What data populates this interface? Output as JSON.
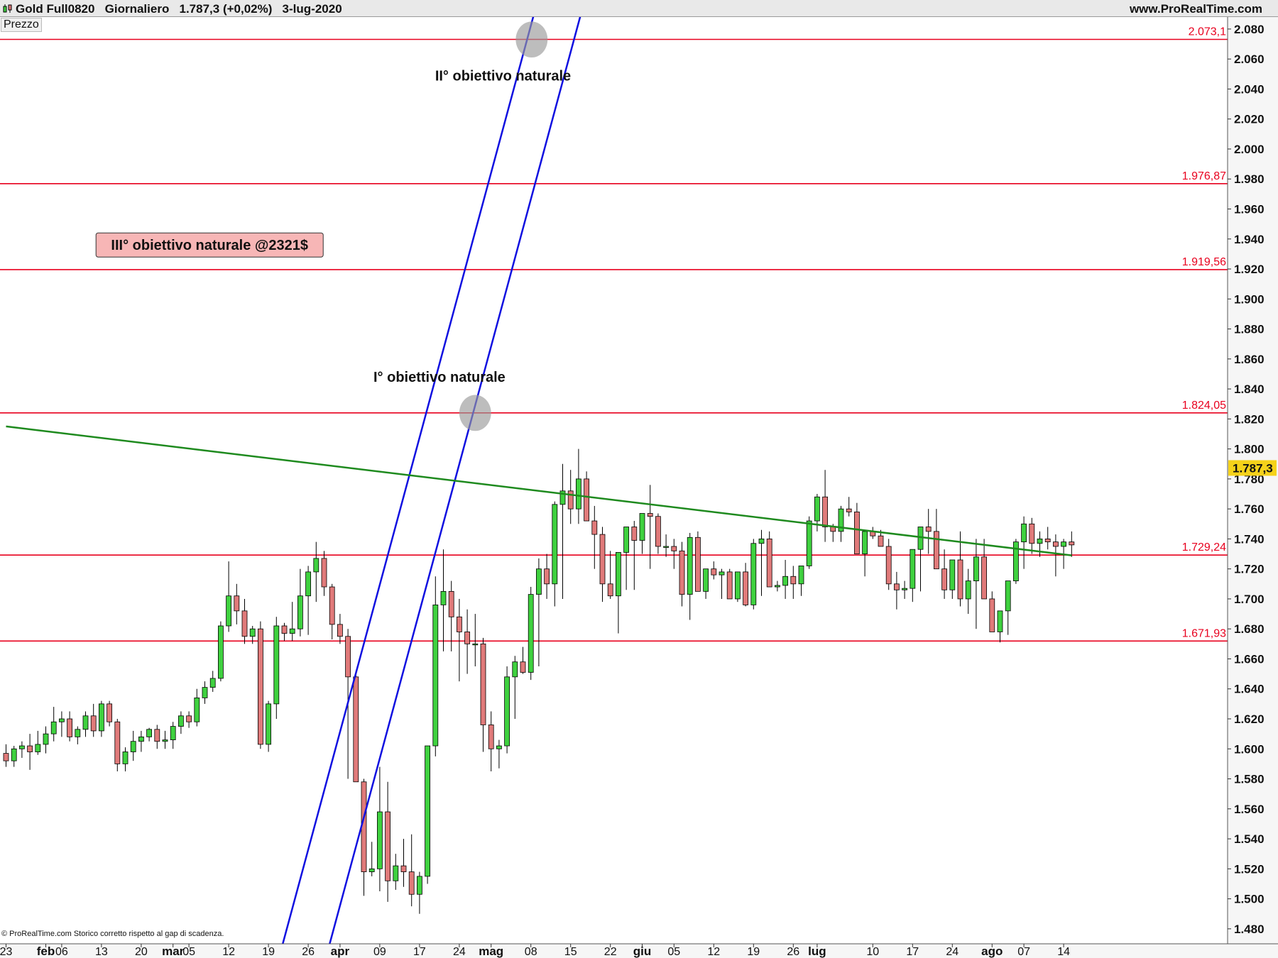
{
  "header": {
    "title": "Gold Full0820   Giornaliero   1.787,3 (+0,02%)   3-lug-2020",
    "website": "www.ProRealTime.com"
  },
  "panel_label": "Prezzo",
  "footer": {
    "copyright": "© ProRealTime.com  Storico corretto rispetto al gap di scadenza."
  },
  "colors": {
    "up": "#3fd13f",
    "down": "#e07a7a",
    "level": "#e8001e",
    "channel": "#1010e0",
    "trend": "#1e8a1e",
    "last_price_bg": "#f5d21a"
  },
  "chart_data": {
    "type": "candlestick",
    "ylim": [
      1470,
      2088
    ],
    "y_ticks": [
      "2.080",
      "2.060",
      "2.040",
      "2.020",
      "2.000",
      "1.980",
      "1.960",
      "1.940",
      "1.920",
      "1.900",
      "1.880",
      "1.860",
      "1.840",
      "1.820",
      "1.800",
      "1.780",
      "1.760",
      "1.740",
      "1.720",
      "1.700",
      "1.680",
      "1.660",
      "1.640",
      "1.620",
      "1.600",
      "1.580",
      "1.560",
      "1.540",
      "1.520",
      "1.500",
      "1.480"
    ],
    "x_ticks": [
      {
        "i": 0,
        "label": "23"
      },
      {
        "i": 5,
        "label": "feb"
      },
      {
        "i": 7,
        "label": "06"
      },
      {
        "i": 12,
        "label": "13"
      },
      {
        "i": 17,
        "label": "20"
      },
      {
        "i": 21,
        "label": "mar"
      },
      {
        "i": 23,
        "label": "05"
      },
      {
        "i": 28,
        "label": "12"
      },
      {
        "i": 33,
        "label": "19"
      },
      {
        "i": 38,
        "label": "26"
      },
      {
        "i": 42,
        "label": "apr"
      },
      {
        "i": 47,
        "label": "09"
      },
      {
        "i": 52,
        "label": "17"
      },
      {
        "i": 57,
        "label": "24"
      },
      {
        "i": 61,
        "label": "mag"
      },
      {
        "i": 66,
        "label": "08"
      },
      {
        "i": 71,
        "label": "15"
      },
      {
        "i": 76,
        "label": "22"
      },
      {
        "i": 80,
        "label": "giu"
      },
      {
        "i": 84,
        "label": "05"
      },
      {
        "i": 89,
        "label": "12"
      },
      {
        "i": 94,
        "label": "19"
      },
      {
        "i": 99,
        "label": "26"
      },
      {
        "i": 102,
        "label": "lug"
      },
      {
        "i": 109,
        "label": "10"
      },
      {
        "i": 114,
        "label": "17"
      },
      {
        "i": 119,
        "label": "24"
      },
      {
        "i": 124,
        "label": "ago"
      },
      {
        "i": 128,
        "label": "07"
      },
      {
        "i": 133,
        "label": "14"
      }
    ],
    "last_price": {
      "value": 1787.3,
      "label": "1.787,3"
    },
    "levels": [
      {
        "value": 2073.1,
        "label": "2.073,1"
      },
      {
        "value": 1976.87,
        "label": "1.976,87"
      },
      {
        "value": 1919.56,
        "label": "1.919,56"
      },
      {
        "value": 1824.05,
        "label": "1.824,05"
      },
      {
        "value": 1729.24,
        "label": "1.729,24"
      },
      {
        "value": 1671.93,
        "label": "1.671,93"
      }
    ],
    "channel_lines": [
      {
        "from": {
          "i": 34.8,
          "price": 1470
        },
        "to": {
          "i": 66.8,
          "price": 2098
        }
      },
      {
        "from": {
          "i": 40.7,
          "price": 1470
        },
        "to": {
          "i": 72.7,
          "price": 2098
        }
      }
    ],
    "trendline": {
      "from": {
        "i": 0,
        "price": 1815
      },
      "to": {
        "i": 134,
        "price": 1729
      }
    },
    "markers": [
      {
        "i": 66.1,
        "price": 2073,
        "rx": 2.0,
        "ry": 12
      },
      {
        "i": 59.0,
        "price": 1824,
        "rx": 2.0,
        "ry": 12
      }
    ],
    "annotations": [
      {
        "id": "ii",
        "text": "II° obiettivo naturale",
        "i": 62.5,
        "price": 2049,
        "boxed": false
      },
      {
        "id": "i",
        "text": "I° obiettivo naturale",
        "i": 54.5,
        "price": 1848,
        "boxed": false
      },
      {
        "id": "iii",
        "text": "III° obiettivo naturale @2321$",
        "i": 25.6,
        "price": 1936,
        "boxed": true
      }
    ],
    "candles": [
      [
        1597,
        1603,
        1588,
        1592
      ],
      [
        1592,
        1602,
        1588,
        1600
      ],
      [
        1600,
        1605,
        1594,
        1602
      ],
      [
        1602,
        1610,
        1586,
        1598
      ],
      [
        1598,
        1612,
        1596,
        1603
      ],
      [
        1603,
        1615,
        1597,
        1610
      ],
      [
        1610,
        1628,
        1605,
        1618
      ],
      [
        1618,
        1625,
        1608,
        1620
      ],
      [
        1620,
        1625,
        1605,
        1608
      ],
      [
        1608,
        1615,
        1603,
        1613
      ],
      [
        1613,
        1625,
        1608,
        1622
      ],
      [
        1622,
        1630,
        1608,
        1612
      ],
      [
        1612,
        1632,
        1608,
        1630
      ],
      [
        1630,
        1632,
        1615,
        1618
      ],
      [
        1618,
        1620,
        1585,
        1590
      ],
      [
        1590,
        1601,
        1585,
        1598
      ],
      [
        1598,
        1612,
        1592,
        1605
      ],
      [
        1605,
        1612,
        1598,
        1608
      ],
      [
        1608,
        1614,
        1605,
        1613
      ],
      [
        1613,
        1616,
        1600,
        1605
      ],
      [
        1605,
        1612,
        1600,
        1606
      ],
      [
        1606,
        1618,
        1600,
        1615
      ],
      [
        1615,
        1625,
        1610,
        1622
      ],
      [
        1622,
        1625,
        1614,
        1618
      ],
      [
        1618,
        1640,
        1615,
        1634
      ],
      [
        1634,
        1645,
        1630,
        1641
      ],
      [
        1641,
        1652,
        1638,
        1647
      ],
      [
        1647,
        1685,
        1645,
        1682
      ],
      [
        1682,
        1725,
        1678,
        1702
      ],
      [
        1702,
        1710,
        1683,
        1692
      ],
      [
        1692,
        1700,
        1670,
        1675
      ],
      [
        1675,
        1682,
        1670,
        1680
      ],
      [
        1680,
        1685,
        1600,
        1603
      ],
      [
        1603,
        1632,
        1598,
        1630
      ],
      [
        1630,
        1688,
        1620,
        1682
      ],
      [
        1682,
        1684,
        1672,
        1677
      ],
      [
        1677,
        1698,
        1672,
        1680
      ],
      [
        1680,
        1720,
        1675,
        1702
      ],
      [
        1702,
        1722,
        1676,
        1718
      ],
      [
        1718,
        1738,
        1698,
        1727
      ],
      [
        1727,
        1732,
        1702,
        1708
      ],
      [
        1708,
        1710,
        1673,
        1683
      ],
      [
        1683,
        1690,
        1670,
        1675
      ],
      [
        1675,
        1680,
        1580,
        1648
      ],
      [
        1648,
        1652,
        1595,
        1578
      ],
      [
        1578,
        1580,
        1502,
        1518
      ],
      [
        1518,
        1538,
        1515,
        1520
      ],
      [
        1520,
        1588,
        1505,
        1558
      ],
      [
        1558,
        1578,
        1498,
        1512
      ],
      [
        1512,
        1530,
        1506,
        1522
      ],
      [
        1522,
        1540,
        1508,
        1518
      ],
      [
        1518,
        1543,
        1495,
        1503
      ],
      [
        1503,
        1518,
        1490,
        1515
      ],
      [
        1515,
        1602,
        1510,
        1602
      ],
      [
        1602,
        1715,
        1595,
        1696
      ],
      [
        1696,
        1733,
        1665,
        1705
      ],
      [
        1705,
        1712,
        1665,
        1688
      ],
      [
        1688,
        1700,
        1645,
        1678
      ],
      [
        1678,
        1693,
        1650,
        1670
      ],
      [
        1670,
        1690,
        1655,
        1670
      ],
      [
        1670,
        1674,
        1598,
        1616
      ],
      [
        1616,
        1625,
        1585,
        1600
      ],
      [
        1600,
        1606,
        1587,
        1602
      ],
      [
        1602,
        1655,
        1597,
        1648
      ],
      [
        1648,
        1662,
        1620,
        1658
      ],
      [
        1658,
        1668,
        1650,
        1651
      ],
      [
        1651,
        1708,
        1646,
        1703
      ],
      [
        1703,
        1727,
        1655,
        1720
      ],
      [
        1720,
        1730,
        1700,
        1710
      ],
      [
        1710,
        1765,
        1695,
        1763
      ],
      [
        1763,
        1790,
        1700,
        1772
      ],
      [
        1772,
        1786,
        1750,
        1760
      ],
      [
        1760,
        1800,
        1750,
        1780
      ],
      [
        1780,
        1785,
        1760,
        1752
      ],
      [
        1752,
        1762,
        1720,
        1743
      ],
      [
        1743,
        1748,
        1698,
        1710
      ],
      [
        1710,
        1732,
        1700,
        1702
      ],
      [
        1702,
        1728,
        1677,
        1731
      ],
      [
        1731,
        1740,
        1706,
        1748
      ],
      [
        1748,
        1752,
        1706,
        1739
      ],
      [
        1739,
        1755,
        1730,
        1757
      ],
      [
        1757,
        1776,
        1720,
        1755
      ],
      [
        1755,
        1757,
        1730,
        1735
      ],
      [
        1735,
        1743,
        1728,
        1735
      ],
      [
        1735,
        1740,
        1720,
        1732
      ],
      [
        1732,
        1738,
        1695,
        1703
      ],
      [
        1703,
        1744,
        1686,
        1741
      ],
      [
        1741,
        1745,
        1705,
        1705
      ],
      [
        1705,
        1715,
        1700,
        1720
      ],
      [
        1720,
        1725,
        1713,
        1716
      ],
      [
        1716,
        1720,
        1700,
        1718
      ],
      [
        1718,
        1720,
        1705,
        1700
      ],
      [
        1700,
        1712,
        1698,
        1718
      ],
      [
        1718,
        1724,
        1695,
        1696
      ],
      [
        1696,
        1740,
        1693,
        1737
      ],
      [
        1737,
        1746,
        1702,
        1740
      ],
      [
        1740,
        1745,
        1733,
        1708
      ],
      [
        1708,
        1712,
        1705,
        1709
      ],
      [
        1709,
        1726,
        1700,
        1715
      ],
      [
        1715,
        1722,
        1700,
        1710
      ],
      [
        1710,
        1720,
        1702,
        1722
      ],
      [
        1722,
        1755,
        1720,
        1752
      ],
      [
        1752,
        1770,
        1745,
        1768
      ],
      [
        1768,
        1786,
        1738,
        1748
      ],
      [
        1748,
        1750,
        1738,
        1745
      ],
      [
        1745,
        1762,
        1738,
        1760
      ],
      [
        1760,
        1768,
        1755,
        1758
      ],
      [
        1758,
        1764,
        1730,
        1730
      ],
      [
        1730,
        1740,
        1715,
        1745
      ],
      [
        1745,
        1748,
        1740,
        1742
      ],
      [
        1742,
        1746,
        1738,
        1735
      ],
      [
        1735,
        1740,
        1706,
        1710
      ],
      [
        1710,
        1718,
        1693,
        1706
      ],
      [
        1706,
        1712,
        1700,
        1707
      ],
      [
        1707,
        1712,
        1698,
        1733
      ],
      [
        1733,
        1748,
        1705,
        1748
      ],
      [
        1748,
        1760,
        1730,
        1745
      ],
      [
        1745,
        1760,
        1725,
        1720
      ],
      [
        1720,
        1733,
        1700,
        1706
      ],
      [
        1706,
        1722,
        1700,
        1726
      ],
      [
        1726,
        1745,
        1695,
        1700
      ],
      [
        1700,
        1720,
        1690,
        1712
      ],
      [
        1712,
        1740,
        1680,
        1728
      ],
      [
        1728,
        1740,
        1710,
        1700
      ],
      [
        1700,
        1705,
        1680,
        1678
      ],
      [
        1678,
        1690,
        1671,
        1692
      ],
      [
        1692,
        1705,
        1676,
        1712
      ],
      [
        1712,
        1740,
        1710,
        1738
      ],
      [
        1738,
        1755,
        1720,
        1750
      ],
      [
        1750,
        1754,
        1730,
        1737
      ],
      [
        1737,
        1745,
        1728,
        1740
      ],
      [
        1740,
        1748,
        1733,
        1738
      ],
      [
        1738,
        1743,
        1715,
        1735
      ],
      [
        1735,
        1740,
        1720,
        1738
      ],
      [
        1738,
        1745,
        1728,
        1736
      ]
    ]
  }
}
